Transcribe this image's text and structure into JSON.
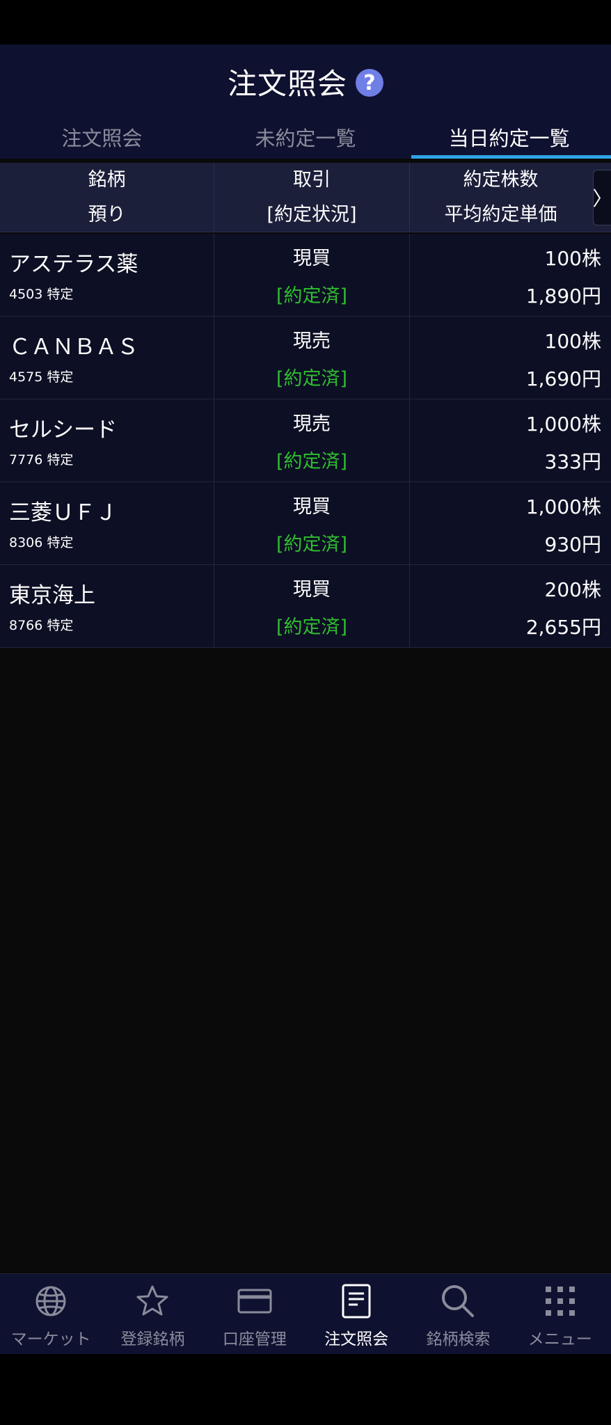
{
  "header": {
    "title": "注文照会",
    "help_symbol": "?"
  },
  "tabs": [
    {
      "label": "注文照会",
      "active": false
    },
    {
      "label": "未約定一覧",
      "active": false
    },
    {
      "label": "当日約定一覧",
      "active": true
    }
  ],
  "table": {
    "headers": {
      "col1_line1": "銘柄",
      "col1_line2": "預り",
      "col2_line1": "取引",
      "col2_line2": "[約定状況]",
      "col3_line1": "約定株数",
      "col3_line2": "平均約定単価"
    },
    "scroll_symbol": "〉",
    "rows": [
      {
        "name": "アステラス薬",
        "code": "4503 特定",
        "type": "現買",
        "status": "[約定済]",
        "qty": "100株",
        "price": "1,890円"
      },
      {
        "name": "ＣＡＮＢＡＳ",
        "code": "4575 特定",
        "type": "現売",
        "status": "[約定済]",
        "qty": "100株",
        "price": "1,690円"
      },
      {
        "name": "セルシード",
        "code": "7776 特定",
        "type": "現売",
        "status": "[約定済]",
        "qty": "1,000株",
        "price": "333円"
      },
      {
        "name": "三菱ＵＦＪ",
        "code": "8306 特定",
        "type": "現買",
        "status": "[約定済]",
        "qty": "1,000株",
        "price": "930円"
      },
      {
        "name": "東京海上",
        "code": "8766 特定",
        "type": "現買",
        "status": "[約定済]",
        "qty": "200株",
        "price": "2,655円"
      }
    ]
  },
  "bottom_nav": [
    {
      "label": "マーケット",
      "icon": "globe-icon",
      "active": false
    },
    {
      "label": "登録銘柄",
      "icon": "star-icon",
      "active": false
    },
    {
      "label": "口座管理",
      "icon": "card-icon",
      "active": false
    },
    {
      "label": "注文照会",
      "icon": "document-icon",
      "active": true
    },
    {
      "label": "銘柄検索",
      "icon": "search-icon",
      "active": false
    },
    {
      "label": "メニュー",
      "icon": "grid-icon",
      "active": false
    }
  ],
  "colors": {
    "header_bg": "#0f1130",
    "tab_indicator": "#2fa3e6",
    "status_green": "#2fbf2f",
    "help_icon": "#6f7fe6"
  }
}
